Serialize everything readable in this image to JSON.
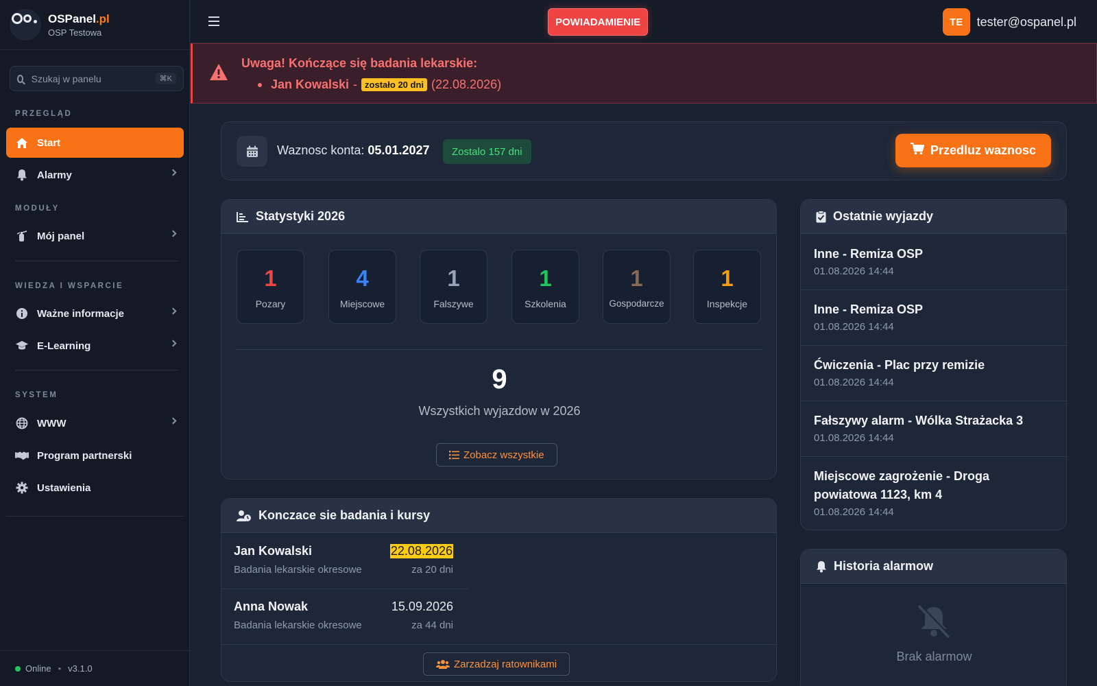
{
  "brand": {
    "name": "OSPanel",
    "suffix": ".pl",
    "org": "OSP Testowa"
  },
  "search": {
    "placeholder": "Szukaj w panelu",
    "shortcut": "⌘K"
  },
  "sidebar": {
    "sections": {
      "overview": "PRZEGLĄD",
      "modules": "MODUŁY",
      "knowledge": "WIEDZA I WSPARCIE",
      "system": "SYSTEM"
    },
    "items": [
      {
        "label": "Start",
        "icon": "home-icon",
        "active": true
      },
      {
        "label": "Alarmy",
        "icon": "bell-icon"
      },
      {
        "label": "Mój panel",
        "icon": "extinguisher-icon"
      },
      {
        "label": "Ważne informacje",
        "icon": "info-icon"
      },
      {
        "label": "E-Learning",
        "icon": "graduation-cap-icon"
      },
      {
        "label": "WWW",
        "icon": "globe-icon"
      },
      {
        "label": "Program partnerski",
        "icon": "handshake-icon"
      },
      {
        "label": "Ustawienia",
        "icon": "gear-icon"
      }
    ],
    "footer": {
      "status": "Online",
      "version": "v3.1.0"
    }
  },
  "topbar": {
    "notification": "POWIADAMIENIE",
    "avatar": "TE",
    "email": "tester@ospanel.pl"
  },
  "alert": {
    "title": "Uwaga! Kończące się badania lekarskie:",
    "name": "Jan Kowalski",
    "dash": "-",
    "badge": "zostało 20 dni",
    "date": "(22.08.2026)"
  },
  "validity": {
    "label": "Waznosc konta:",
    "date": "05.01.2027",
    "remaining": "Zostalo 157 dni",
    "extend": "Przedluz waznosc"
  },
  "stats": {
    "title": "Statystyki 2026",
    "items": [
      {
        "value": "1",
        "label": "Pozary",
        "color": "#ef4444"
      },
      {
        "value": "4",
        "label": "Miejscowe",
        "color": "#3b82f6"
      },
      {
        "value": "1",
        "label": "Falszywe",
        "color": "#94a3b8"
      },
      {
        "value": "1",
        "label": "Szkolenia",
        "color": "#22c55e"
      },
      {
        "value": "1",
        "label": "Gospodarcze",
        "color": "#8b6a55"
      },
      {
        "value": "1",
        "label": "Inspekcje",
        "color": "#f59e0b"
      }
    ],
    "total": "9",
    "total_label": "Wszystkich wyjazdow w 2026",
    "see_all": "Zobacz wszystkie"
  },
  "courses": {
    "title": "Konczace sie badania i kursy",
    "rows": [
      {
        "name": "Jan Kowalski",
        "type": "Badania lekarskie okresowe",
        "date": "22.08.2026",
        "left": "za 20 dni",
        "highlight": true
      },
      {
        "name": "Anna Nowak",
        "type": "Badania lekarskie okresowe",
        "date": "15.09.2026",
        "left": "za 44 dni",
        "highlight": false
      }
    ],
    "manage": "Zarzadzaj ratownikami"
  },
  "trips": {
    "title": "Ostatnie wyjazdy",
    "items": [
      {
        "title": "Inne - Remiza OSP",
        "time": "01.08.2026 14:44"
      },
      {
        "title": "Inne - Remiza OSP",
        "time": "01.08.2026 14:44"
      },
      {
        "title": "Ćwiczenia - Plac przy remizie",
        "time": "01.08.2026 14:44"
      },
      {
        "title": "Fałszywy alarm - Wólka Strażacka 3",
        "time": "01.08.2026 14:44"
      },
      {
        "title": "Miejscowe zagrożenie - Droga powiatowa 1123, km 4",
        "time": "01.08.2026 14:44"
      }
    ]
  },
  "history": {
    "title": "Historia alarmow",
    "empty": "Brak alarmow"
  },
  "colors": {
    "accent": "#f97316",
    "danger": "#ef4444",
    "success": "#22c55e",
    "highlight": "#facc15"
  }
}
